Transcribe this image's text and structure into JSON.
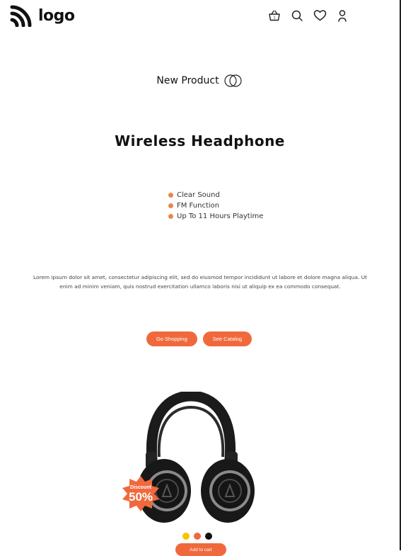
{
  "header": {
    "logo_text": "logo",
    "icons": [
      "basket-icon",
      "search-icon",
      "heart-icon",
      "user-icon"
    ],
    "cart_count": "1"
  },
  "hero": {
    "eyebrow": "New Product",
    "title": "Wireless Headphone",
    "features": [
      "Clear Sound",
      "FM Function",
      "Up To 11 Hours Playtime"
    ],
    "description": "Lorem ipsum dolor sit amet, consectetur adipiscing elit, sed do eiusmod tempor incididunt ut labore et dolore magna aliqua. Ut enim ad minim veniam, quis nostrud exercitation ullamco laboris nisi ut aliquip ex ea commodo consequat.",
    "primary_button": "Go Shopping",
    "secondary_button": "See Catalog"
  },
  "product": {
    "badge_label": "Discount",
    "badge_value": "50%",
    "color_options": [
      "#f5c400",
      "#f0693d",
      "#111111"
    ],
    "add_to_cart": "Add to cart"
  },
  "colors": {
    "accent": "#f0693d",
    "bullet": "#e8874b"
  }
}
